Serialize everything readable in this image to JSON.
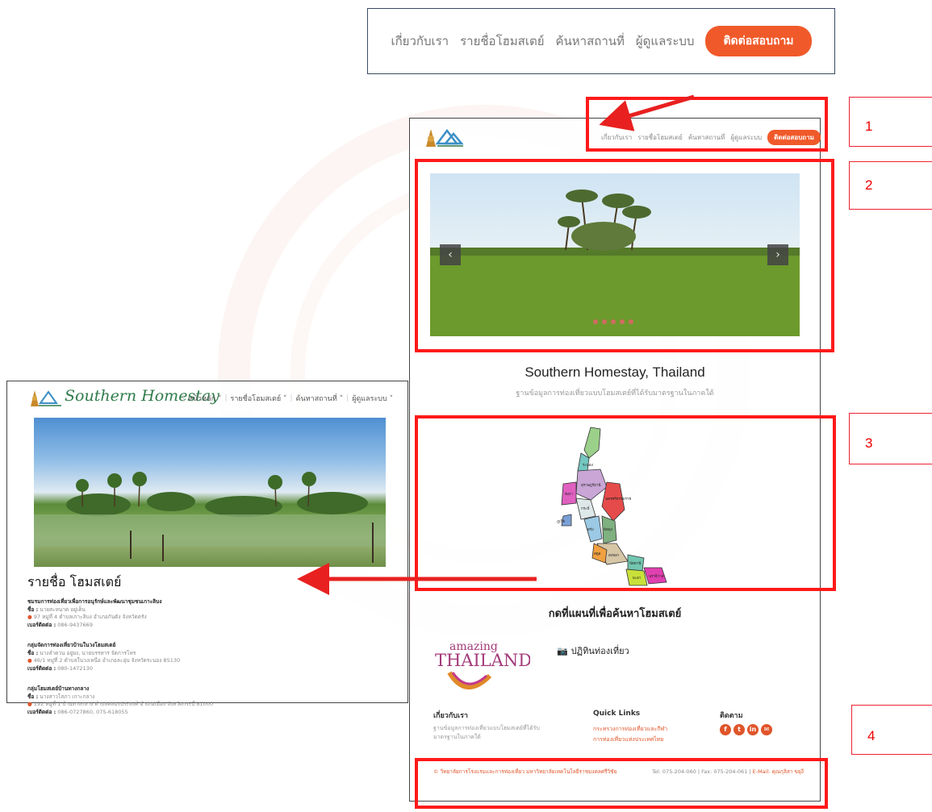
{
  "top_menu": {
    "items": [
      "เกี่ยวกับเรา",
      "รายชื่อโฮมสเตย์",
      "ค้นหาสถานที่",
      "ผู้ดูแลระบบ"
    ],
    "cta": "ติดต่อสอบถาม"
  },
  "main_site": {
    "menu": [
      "เกี่ยวกับเรา",
      "รายชื่อโฮมสเตย์",
      "ค้นหาสถานที่",
      "ผู้ดูแลระบบ"
    ],
    "cta": "ติดต่อสอบถาม",
    "slider": {
      "prev": "‹",
      "next": "›",
      "dots": 5
    },
    "title": "Southern Homestay, Thailand",
    "subtitle": "ฐานข้อมูลการท่องเที่ยวแบบโฮมสเตย์ที่ได้รับมาตรฐานในภาคใต้",
    "map_caption": "กดที่แผนที่เพื่อค้นหาโฮมสเตย์",
    "amazing_small": "amazing",
    "amazing_big": "THAILAND",
    "tour_calendar": "ปฏิทินท่องเที่ยว",
    "footer": {
      "about_heading": "เกี่ยวกับเรา",
      "about_text": "ฐานข้อมูลการท่องเที่ยวแบบโฮมสเตย์ที่ได้รับมาตรฐานในภาคใต้",
      "links_heading": "Quick Links",
      "links": [
        "กระทรวงการท่องเที่ยวและกีฬา",
        "การท่องเที่ยวแห่งประเทศไทย"
      ],
      "follow_heading": "ติดตาม",
      "social": [
        "f",
        "t",
        "in",
        "✉"
      ],
      "copyright": "© วิทยาลัยการโรงแรมและการท่องเที่ยว มหาวิทยาลัยเทคโนโลยีราชมงคลศรีวิชัย",
      "contact": "Tel: 075-204-060 | Fax: 075-204-061 | ",
      "email_label": "E-Mail: คุณกุลิสา ขยุงี"
    },
    "provinces": [
      "ระนอง",
      "สุราษฎร์ธานี",
      "พังงา",
      "นครศรีธรรมราช",
      "กระบี่",
      "ภูเก็ต",
      "ตรัง",
      "พัทลุง",
      "สงขลา",
      "สตูล",
      "ปัตตานี",
      "ยะลา",
      "นราธิวาส"
    ]
  },
  "inset": {
    "brand": "Southern Homestay",
    "menu": [
      "หน้าหลัก ˅",
      "รายชื่อโฮมสเตย์ ˅",
      "ค้นหาสถานที่ ˅",
      "ผู้ดูแลระบบ ˅"
    ],
    "title": "รายชื่อ โฮมสเตย์",
    "items": [
      {
        "heading": "ชมรมการท่องเที่ยวเพื่อการอนุรักษ์และพัฒนาชุมชนเกาะลิบง",
        "name_label": "ชื่อ :",
        "name": " นายสะหนาด อยู่เด็น",
        "address": "97 หมู่ที่ 4 ตำบลเกาะลิบง อำเภอกันตัง จังหวัดตรัง",
        "phone_label": "เบอร์ติดต่อ :",
        "phone": " 086-9437669"
      },
      {
        "heading": "กลุ่มจัดการท่องเที่ยวบ้านในวงโฮมสเตย์",
        "name_label": "ชื่อ :",
        "name": " นางลำดวน อยู่ยง, นายบรรหาร จัดการโหร",
        "address": "46/1 หมู่ที่ 2 ตำบลในวงเหนือ อำเภอละอุ่น จังหวัดระนอง 85130",
        "phone_label": "เบอร์ติดต่อ :",
        "phone": " 080-1472130"
      },
      {
        "heading": "กลุ่มโฮมสเตย์บ้านทางกลาง",
        "name_label": "ชื่อ :",
        "name": " นางสาวโสภา เกาะกลาง",
        "address": "192 หมู่ที่ 1 บ้านทางกลาง ตำบลคลองประสงค์ อำเภอเมือง จังหวัดกระบี่ 81000",
        "phone_label": "เบอร์ติดต่อ :",
        "phone": " 086-0727860, 075-618055"
      }
    ]
  },
  "annotations": [
    "1",
    "2",
    "3",
    "4"
  ],
  "colors": {
    "accent": "#f05a2a",
    "annotation": "#ff1a1a",
    "brand_green": "#2f7b4a"
  }
}
